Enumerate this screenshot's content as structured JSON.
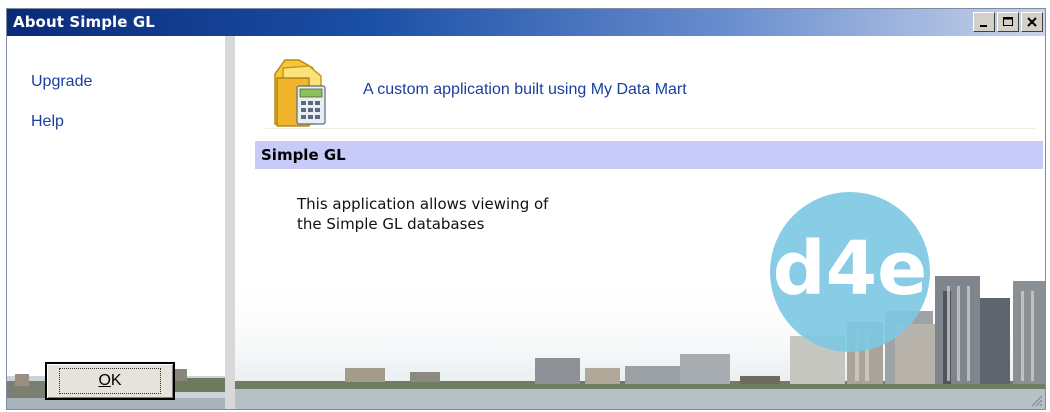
{
  "window": {
    "title": "About Simple GL",
    "controls": {
      "minimize": "minimize-icon",
      "maximize": "maximize-icon",
      "close": "close-icon"
    }
  },
  "sidebar": {
    "links": [
      {
        "label": "Upgrade"
      },
      {
        "label": "Help"
      }
    ],
    "ok_button": {
      "label_underlined": "O",
      "label_rest": "K"
    }
  },
  "main": {
    "icon": "folder-calculator-icon",
    "tagline": "A custom application built using My Data Mart",
    "section_title": "Simple GL",
    "description_line1": "This application allows viewing of",
    "description_line2": "the Simple GL databases",
    "logo_text": "d4e"
  },
  "colors": {
    "title_bar": "#0a2a78",
    "link": "#1a3fa0",
    "section_bar": "#c8cbf7",
    "logo_circle": "#7ec8e3"
  }
}
